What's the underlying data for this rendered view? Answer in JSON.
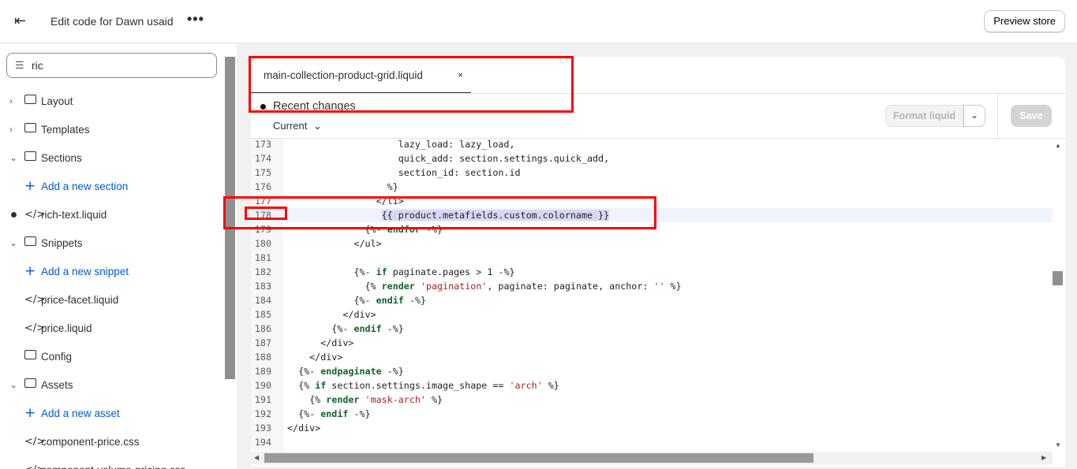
{
  "header": {
    "title": "Edit code for Dawn usaid",
    "more": "•••",
    "preview_label": "Preview store"
  },
  "sidebar": {
    "search_value": "ric",
    "items": [
      {
        "type": "folder",
        "label": "Layout",
        "expanded": false
      },
      {
        "type": "folder",
        "label": "Templates",
        "expanded": false
      },
      {
        "type": "folder",
        "label": "Sections",
        "expanded": true
      },
      {
        "type": "add",
        "label": "Add a new section"
      },
      {
        "type": "file",
        "label": "rich-text.liquid",
        "modified": true
      },
      {
        "type": "folder",
        "label": "Snippets",
        "expanded": true
      },
      {
        "type": "add",
        "label": "Add a new snippet"
      },
      {
        "type": "file",
        "label": "price-facet.liquid"
      },
      {
        "type": "file",
        "label": "price.liquid"
      },
      {
        "type": "folder",
        "label": "Config",
        "expanded": null
      },
      {
        "type": "folder",
        "label": "Assets",
        "expanded": true
      },
      {
        "type": "add",
        "label": "Add a new asset"
      },
      {
        "type": "file",
        "label": "component-price.css"
      },
      {
        "type": "file",
        "label": "component-volume-pricing.css"
      }
    ]
  },
  "editor": {
    "tab_label": "main-collection-product-grid.liquid",
    "tab_close": "×",
    "recent_changes": "Recent changes",
    "version_select": "Current",
    "format_label": "Format liquid",
    "save_label": "Save",
    "active_line": 178,
    "code_lines": [
      {
        "n": 173,
        "t": "                    lazy_load: lazy_load,"
      },
      {
        "n": 174,
        "t": "                    quick_add: section.settings.quick_add,"
      },
      {
        "n": 175,
        "t": "                    section_id: section.id"
      },
      {
        "n": 176,
        "t": "                  %}"
      },
      {
        "n": 177,
        "t": "                </li>"
      },
      {
        "n": 178,
        "t": "                 {{ product.metafields.custom.colorname }}"
      },
      {
        "n": 179,
        "t": "              {%- endfor -%}"
      },
      {
        "n": 180,
        "t": "            </ul>"
      },
      {
        "n": 181,
        "t": ""
      },
      {
        "n": 182,
        "t": "            {%- if paginate.pages > 1 -%}"
      },
      {
        "n": 183,
        "t": "              {% render 'pagination', paginate: paginate, anchor: '' %}"
      },
      {
        "n": 184,
        "t": "            {%- endif -%}"
      },
      {
        "n": 185,
        "t": "          </div>"
      },
      {
        "n": 186,
        "t": "        {%- endif -%}"
      },
      {
        "n": 187,
        "t": "      </div>"
      },
      {
        "n": 188,
        "t": "    </div>"
      },
      {
        "n": 189,
        "t": "  {%- endpaginate -%}"
      },
      {
        "n": 190,
        "t": "  {% if section.settings.image_shape == 'arch' %}"
      },
      {
        "n": 191,
        "t": "    {% render 'mask-arch' %}"
      },
      {
        "n": 192,
        "t": "  {%- endif -%}"
      },
      {
        "n": 193,
        "t": "</div>"
      },
      {
        "n": 194,
        "t": ""
      }
    ]
  }
}
